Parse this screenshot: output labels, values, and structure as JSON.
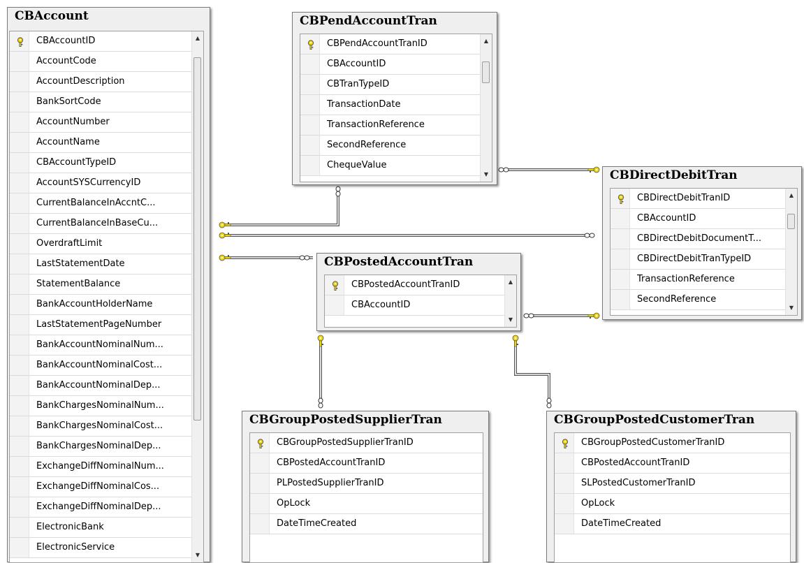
{
  "tables": {
    "cbaccount": {
      "title": "CBAccount",
      "columns": [
        "CBAccountID",
        "AccountCode",
        "AccountDescription",
        "BankSortCode",
        "AccountNumber",
        "AccountName",
        "CBAccountTypeID",
        "AccountSYSCurrencyID",
        "CurrentBalanceInAccntC...",
        "CurrentBalanceInBaseCu...",
        "OverdraftLimit",
        "LastStatementDate",
        "StatementBalance",
        "BankAccountHolderName",
        "LastStatementPageNumber",
        "BankAccountNominalNum...",
        "BankAccountNominalCost...",
        "BankAccountNominalDep...",
        "BankChargesNominalNum...",
        "BankChargesNominalCost...",
        "BankChargesNominalDep...",
        "ExchangeDiffNominalNum...",
        "ExchangeDiffNominalCos...",
        "ExchangeDiffNominalDep...",
        "ElectronicBank",
        "ElectronicService"
      ],
      "keys": [
        0
      ]
    },
    "cbpendaccounttran": {
      "title": "CBPendAccountTran",
      "columns": [
        "CBPendAccountTranID",
        "CBAccountID",
        "CBTranTypeID",
        "TransactionDate",
        "TransactionReference",
        "SecondReference",
        "ChequeValue"
      ],
      "keys": [
        0
      ]
    },
    "cbdirectdebittran": {
      "title": "CBDirectDebitTran",
      "columns": [
        "CBDirectDebitTranID",
        "CBAccountID",
        "CBDirectDebitDocumentT...",
        "CBDirectDebitTranTypeID",
        "TransactionReference",
        "SecondReference"
      ],
      "keys": [
        0
      ]
    },
    "cbpostedaccounttran": {
      "title": "CBPostedAccountTran",
      "columns": [
        "CBPostedAccountTranID",
        "CBAccountID"
      ],
      "keys": [
        0
      ]
    },
    "cbgrouppostedsuppliertran": {
      "title": "CBGroupPostedSupplierTran",
      "columns": [
        "CBGroupPostedSupplierTranID",
        "CBPostedAccountTranID",
        "PLPostedSupplierTranID",
        "OpLock",
        "DateTimeCreated"
      ],
      "keys": [
        0
      ]
    },
    "cbgrouppostedcustomertran": {
      "title": "CBGroupPostedCustomerTran",
      "columns": [
        "CBGroupPostedCustomerTranID",
        "CBPostedAccountTranID",
        "SLPostedCustomerTranID",
        "OpLock",
        "DateTimeCreated"
      ],
      "keys": [
        0
      ]
    }
  },
  "colors": {
    "key_fill": "#f2d600",
    "key_stroke": "#555555",
    "line": "#555555",
    "header_bg": "#efefef"
  },
  "icons": {
    "primary_key": "key-icon",
    "relationship_one": "key-end-icon",
    "relationship_many": "infinity-end-icon"
  }
}
